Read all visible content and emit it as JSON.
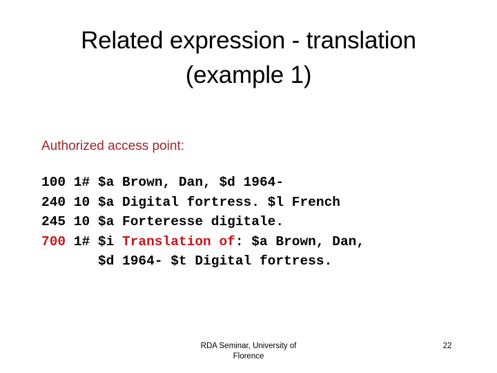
{
  "slide": {
    "background_color": "#ffffff",
    "title": {
      "line1": "Related expression - translation",
      "line2": "(example 1)",
      "color": "#000000"
    },
    "heading": {
      "text": "Authorized access point:",
      "color": "#a52226"
    },
    "colors": {
      "accent_red": "#c0181c",
      "heading_red": "#a52226",
      "text_black": "#000000"
    },
    "marc_records": [
      {
        "tag": "100",
        "tag_color": "#000000",
        "indicators": "1#",
        "segments": [
          {
            "text": "100 1# $a Brown, Dan, $d 1964-",
            "color": "#000000"
          }
        ]
      },
      {
        "tag": "240",
        "tag_color": "#000000",
        "indicators": "10",
        "segments": [
          {
            "text": "240 10 $a Digital fortress. $l French",
            "color": "#000000"
          }
        ]
      },
      {
        "tag": "245",
        "tag_color": "#000000",
        "indicators": "10",
        "segments": [
          {
            "text": "245 10 $a Forteresse digitale.",
            "color": "#000000"
          }
        ]
      },
      {
        "tag": "700",
        "tag_color": "#c0181c",
        "indicators": "1#",
        "segments": [
          {
            "text": "700",
            "color": "#c0181c"
          },
          {
            "text": " 1# $i ",
            "color": "#000000"
          },
          {
            "text": "Translation of",
            "color": "#c0181c"
          },
          {
            "text": ": $a Brown, Dan,",
            "color": "#000000"
          }
        ]
      },
      {
        "tag": "",
        "tag_color": "#000000",
        "indicators": "",
        "segments": [
          {
            "text": "       $d 1964- $t Digital fortress.",
            "color": "#000000"
          }
        ]
      }
    ]
  },
  "footer": {
    "line1": "RDA Seminar, University of",
    "line2": "Florence",
    "page_number": "22"
  }
}
